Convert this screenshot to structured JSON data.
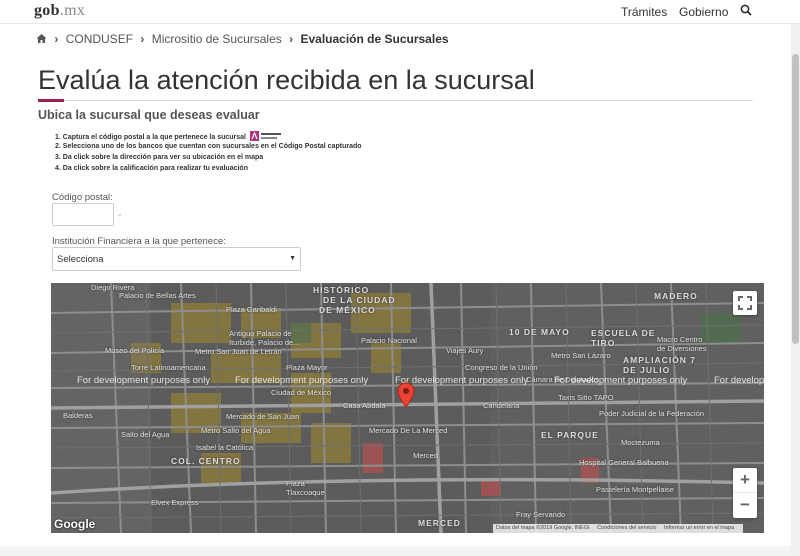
{
  "header": {
    "logo_main": "gob",
    "logo_ext": ".mx",
    "nav": [
      "Trámites",
      "Gobierno"
    ],
    "search_icon": "search-icon"
  },
  "breadcrumb": {
    "items": [
      "CONDUSEF",
      "Micrositio de Sucursales"
    ],
    "current": "Evaluación de Sucursales"
  },
  "page": {
    "title": "Evalúa la atención recibida en la sucursal",
    "subtitle": "Ubica la sucursal que deseas evaluar",
    "accent_color": "#9d2449"
  },
  "steps": [
    "1. Captura el código postal a la que pertenece la sucursal",
    "2. Selecciona uno de los bancos que cuentan con sucursales en el Código Postal capturado",
    "3. Da click sobre la dirección para ver su ubicación en el mapa",
    "4. Da click sobre la calificación para realizar tu evaluación"
  ],
  "form": {
    "postal_label": "Código postal:",
    "postal_value": "",
    "postal_dash": "-",
    "institution_label": "Institución Financiera a la que pertenece:",
    "institution_selected": "Selecciona"
  },
  "map": {
    "dev_text": "For development purposes only",
    "labels": [
      "Diego Rivera",
      "Palacio de Bellas Artes",
      "HISTÓRICO",
      "DE LA CIUDAD",
      "DE MÉXICO",
      "MADERO",
      "Plaza Garibaldi",
      "Antiguo Palacio de Iturbide, Palacio de...",
      "Palacio Nacional",
      "10 DE MAYO",
      "ESCUELA DE TIRO",
      "Museo del Policía",
      "Metro San Juan de Letrán",
      "Viajes Aury",
      "Metro San Lázaro",
      "Macro Centro de Diversiones",
      "AMPLIACIÓN 7 DE JULIO",
      "Torre Latinoamericana",
      "Plaza Mayor",
      "Ciudad de México",
      "Congreso de la Unión",
      "Cámara de Diputados",
      "Casa Abdala",
      "Candelaria",
      "Taxis Sitio TAPO",
      "Poder Judicial de la Federación",
      "Balderas",
      "Mercado de San Juan",
      "Mercado De La Merced",
      "Metro Salto del Agua",
      "Salto del Agua",
      "EL PARQUE",
      "Moctezuma",
      "Isabel la Católica",
      "Merced",
      "COL. CENTRO",
      "Hospital General Balbuena",
      "Pastelería Montpellaise",
      "Plaza Tlaxcoaque",
      "Fray Servando",
      "Elvex Express",
      "MERCED"
    ],
    "footer": [
      "Datos del mapa ©2019 Google, INEGI",
      "Condiciones del servicio",
      "Informar un error en el mapa"
    ],
    "google_label": "Google"
  }
}
